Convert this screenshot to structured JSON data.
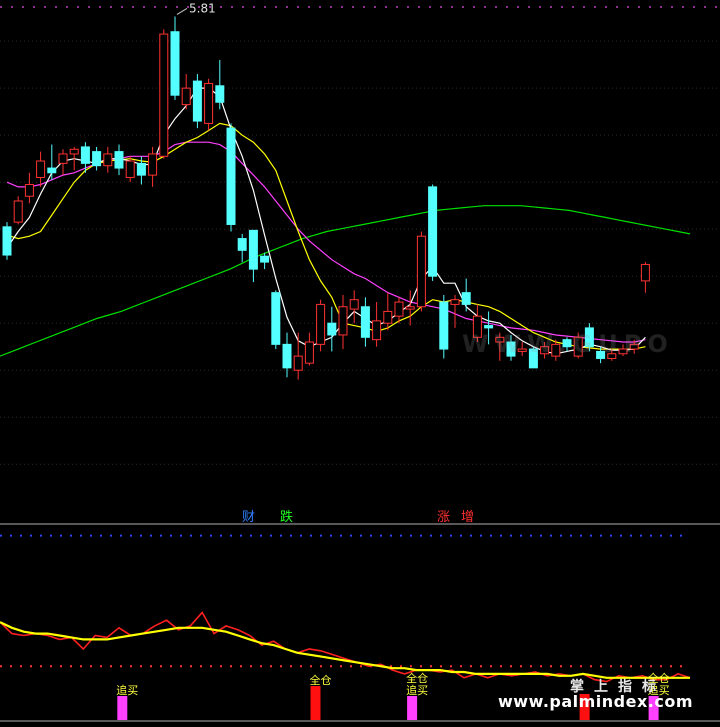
{
  "chart_data": [
    {
      "type": "candlestick",
      "panel": "price",
      "annotation": "5.81",
      "colors": {
        "up": "#ff3232",
        "down": "#54ffff",
        "ma5": "#ffffff",
        "ma10": "#ffff00",
        "ma20": "#ff40ff",
        "ma60": "#00e000"
      },
      "candles": [
        [
          4.02,
          3.78,
          4.06,
          3.74
        ],
        [
          4.06,
          4.24,
          4.28,
          4.04
        ],
        [
          4.28,
          4.38,
          4.48,
          4.22
        ],
        [
          4.44,
          4.58,
          4.66,
          4.36
        ],
        [
          4.52,
          4.48,
          4.72,
          4.42
        ],
        [
          4.56,
          4.64,
          4.68,
          4.46
        ],
        [
          4.64,
          4.68,
          4.7,
          4.5
        ],
        [
          4.7,
          4.56,
          4.74,
          4.48
        ],
        [
          4.66,
          4.54,
          4.7,
          4.5
        ],
        [
          4.54,
          4.64,
          4.7,
          4.48
        ],
        [
          4.66,
          4.52,
          4.72,
          4.46
        ],
        [
          4.44,
          4.58,
          4.62,
          4.4
        ],
        [
          4.56,
          4.46,
          4.62,
          4.38
        ],
        [
          4.46,
          4.64,
          4.7,
          4.36
        ],
        [
          4.62,
          5.66,
          5.7,
          4.6
        ],
        [
          5.68,
          5.14,
          5.81,
          5.1
        ],
        [
          5.06,
          5.2,
          5.32,
          5.02
        ],
        [
          5.26,
          4.92,
          5.32,
          4.86
        ],
        [
          4.9,
          5.24,
          5.28,
          4.84
        ],
        [
          5.22,
          5.08,
          5.44,
          5.02
        ],
        [
          4.86,
          4.04,
          4.9,
          3.98
        ],
        [
          3.92,
          3.82,
          3.96,
          3.72
        ],
        [
          3.99,
          3.66,
          3.98,
          3.55
        ],
        [
          3.77,
          3.72,
          3.8,
          3.66
        ],
        [
          3.46,
          3.02,
          3.48,
          2.98
        ],
        [
          3.02,
          2.82,
          3.12,
          2.74
        ],
        [
          2.8,
          2.92,
          3.12,
          2.72
        ],
        [
          2.86,
          3.04,
          3.12,
          2.84
        ],
        [
          3.02,
          3.36,
          3.4,
          2.96
        ],
        [
          3.2,
          3.1,
          3.34,
          2.96
        ],
        [
          3.1,
          3.34,
          3.44,
          2.98
        ],
        [
          3.32,
          3.4,
          3.48,
          3.2
        ],
        [
          3.34,
          3.08,
          3.42,
          3.0
        ],
        [
          3.06,
          3.22,
          3.38,
          3.0
        ],
        [
          3.2,
          3.3,
          3.46,
          3.14
        ],
        [
          3.26,
          3.38,
          3.42,
          3.2
        ],
        [
          3.32,
          3.34,
          3.48,
          3.18
        ],
        [
          3.34,
          3.94,
          3.98,
          3.3
        ],
        [
          4.36,
          3.6,
          4.38,
          3.56
        ],
        [
          3.38,
          2.98,
          3.44,
          2.9
        ],
        [
          3.36,
          3.4,
          3.44,
          3.16
        ],
        [
          3.46,
          3.36,
          3.58,
          3.3
        ],
        [
          3.08,
          3.26,
          3.36,
          3.04
        ],
        [
          3.18,
          3.16,
          3.3,
          3.02
        ],
        [
          3.04,
          3.08,
          3.12,
          2.88
        ],
        [
          3.04,
          2.92,
          3.1,
          2.88
        ],
        [
          2.96,
          2.98,
          3.04,
          2.92
        ],
        [
          2.98,
          2.82,
          3.0,
          2.82
        ],
        [
          2.94,
          3.0,
          3.04,
          2.9
        ],
        [
          2.92,
          3.02,
          3.06,
          2.88
        ],
        [
          3.06,
          3.0,
          3.08,
          2.96
        ],
        [
          2.92,
          3.08,
          3.12,
          2.9
        ],
        [
          3.16,
          3.0,
          3.2,
          2.96
        ],
        [
          2.96,
          2.9,
          3.0,
          2.86
        ],
        [
          2.9,
          2.94,
          2.98,
          2.88
        ],
        [
          2.94,
          2.98,
          3.02,
          2.92
        ],
        [
          2.98,
          3.02,
          3.06,
          2.94
        ],
        [
          3.56,
          3.7,
          3.72,
          3.46
        ]
      ],
      "ma_lines": {
        "ma5": [
          3.84,
          3.98,
          4.1,
          4.3,
          4.48,
          4.58,
          4.6,
          4.58,
          4.56,
          4.6,
          4.6,
          4.58,
          4.55,
          4.55,
          4.8,
          4.94,
          5.05,
          5.2,
          5.2,
          5.13,
          4.85,
          4.62,
          4.33,
          3.95,
          3.58,
          3.25,
          3.05,
          3.0,
          3.04,
          3.08,
          3.2,
          3.3,
          3.24,
          3.18,
          3.22,
          3.29,
          3.36,
          3.58,
          3.68,
          3.54,
          3.54,
          3.34,
          3.26,
          3.22,
          3.2,
          3.12,
          3.05,
          3.0,
          2.96,
          2.94,
          2.96,
          2.98,
          3.02,
          3.0,
          2.97,
          2.97,
          2.98,
          3.08
        ],
        "ma10": [
          3.95,
          3.92,
          3.94,
          3.98,
          4.12,
          4.26,
          4.4,
          4.5,
          4.56,
          4.58,
          4.59,
          4.6,
          4.58,
          4.57,
          4.62,
          4.68,
          4.74,
          4.78,
          4.84,
          4.9,
          4.88,
          4.8,
          4.74,
          4.64,
          4.5,
          4.24,
          3.98,
          3.74,
          3.56,
          3.42,
          3.2,
          3.18,
          3.16,
          3.13,
          3.16,
          3.22,
          3.26,
          3.34,
          3.4,
          3.38,
          3.4,
          3.38,
          3.36,
          3.34,
          3.3,
          3.24,
          3.18,
          3.12,
          3.08,
          3.04,
          3.02,
          3.0,
          2.99,
          2.98,
          2.98,
          2.98,
          2.98,
          3.0
        ],
        "ma20": [
          4.4,
          4.36,
          4.36,
          4.38,
          4.42,
          4.46,
          4.48,
          4.52,
          4.56,
          4.58,
          4.6,
          4.62,
          4.62,
          4.62,
          4.66,
          4.72,
          4.74,
          4.74,
          4.74,
          4.72,
          4.66,
          4.56,
          4.46,
          4.36,
          4.24,
          4.12,
          4.0,
          3.9,
          3.82,
          3.74,
          3.68,
          3.62,
          3.58,
          3.52,
          3.46,
          3.42,
          3.38,
          3.36,
          3.34,
          3.32,
          3.28,
          3.24,
          3.22,
          3.2,
          3.18,
          3.16,
          3.15,
          3.14,
          3.12,
          3.1,
          3.09,
          3.08,
          3.07,
          3.06,
          3.05,
          3.04,
          3.04,
          3.06
        ],
        "ma60": [
          2.92,
          2.96,
          3.0,
          3.04,
          3.08,
          3.12,
          3.16,
          3.2,
          3.24,
          3.27,
          3.3,
          3.34,
          3.38,
          3.42,
          3.46,
          3.5,
          3.54,
          3.58,
          3.62,
          3.66,
          3.71,
          3.76,
          3.8,
          3.84,
          3.88,
          3.92,
          3.95,
          3.98,
          4.0,
          4.02,
          4.04,
          4.06,
          4.08,
          4.1,
          4.12,
          4.14,
          4.16,
          4.17,
          4.18,
          4.19,
          4.2,
          4.2,
          4.2,
          4.2,
          4.19,
          4.18,
          4.17,
          4.16,
          4.14,
          4.12,
          4.1,
          4.08,
          4.06,
          4.04,
          4.02,
          4.0,
          3.98,
          3.96
        ]
      },
      "ymin": 1.5,
      "ymax": 5.95,
      "labels": [
        "财",
        "跌",
        "涨",
        "增"
      ]
    },
    {
      "type": "line",
      "panel": "indicator",
      "ymin": 0,
      "ymax": 100,
      "dashed_levels": [
        {
          "value": 96,
          "color": "#3040ff"
        },
        {
          "value": 28,
          "color": "#ff3030"
        }
      ],
      "series": [
        {
          "color": "#ff2020",
          "values": [
            51,
            45,
            44,
            45,
            44,
            42,
            43,
            37,
            44,
            43,
            48,
            44,
            45,
            49,
            52,
            47,
            49,
            56,
            45,
            49,
            47,
            44,
            39,
            41,
            37,
            35,
            37,
            36,
            34,
            32,
            30,
            28,
            29,
            26,
            24,
            26,
            26,
            25,
            26,
            22,
            24,
            22,
            24,
            23,
            24,
            25,
            23,
            24,
            23,
            24,
            21,
            20,
            23,
            22,
            23,
            21,
            21,
            24,
            22
          ]
        },
        {
          "color": "#ffff00",
          "values": [
            51,
            48,
            46,
            45,
            45,
            44,
            43,
            42,
            42,
            42,
            43,
            44,
            45,
            46,
            47,
            48,
            48,
            48,
            47,
            46,
            44,
            42,
            40,
            39,
            37,
            35,
            34,
            33,
            32,
            31,
            30,
            29,
            28,
            27,
            27,
            26,
            26,
            26,
            25,
            25,
            24,
            24,
            24,
            24,
            24,
            24,
            24,
            23,
            23,
            24,
            23,
            22,
            22,
            22,
            22,
            22,
            22,
            22,
            22
          ]
        }
      ],
      "markers": [
        {
          "index": 17,
          "label": "追买",
          "color": "#ff40ff",
          "height": 24
        },
        {
          "index": 45,
          "label": "全仓",
          "color": "#ff1010",
          "height": 34
        },
        {
          "index": 59,
          "label": "全仓\n追买",
          "color": "#ff40ff",
          "height": 24
        },
        {
          "index": 84,
          "label": "",
          "color": "#ff1010",
          "height": 26
        },
        {
          "index": 94,
          "label": "全仓\n追买",
          "color": "#ff40ff",
          "height": 24
        }
      ]
    }
  ],
  "watermark": {
    "cn": "掌上指标",
    "url": "www.palmindex.com",
    "ghost": "WWW.GUPO"
  }
}
